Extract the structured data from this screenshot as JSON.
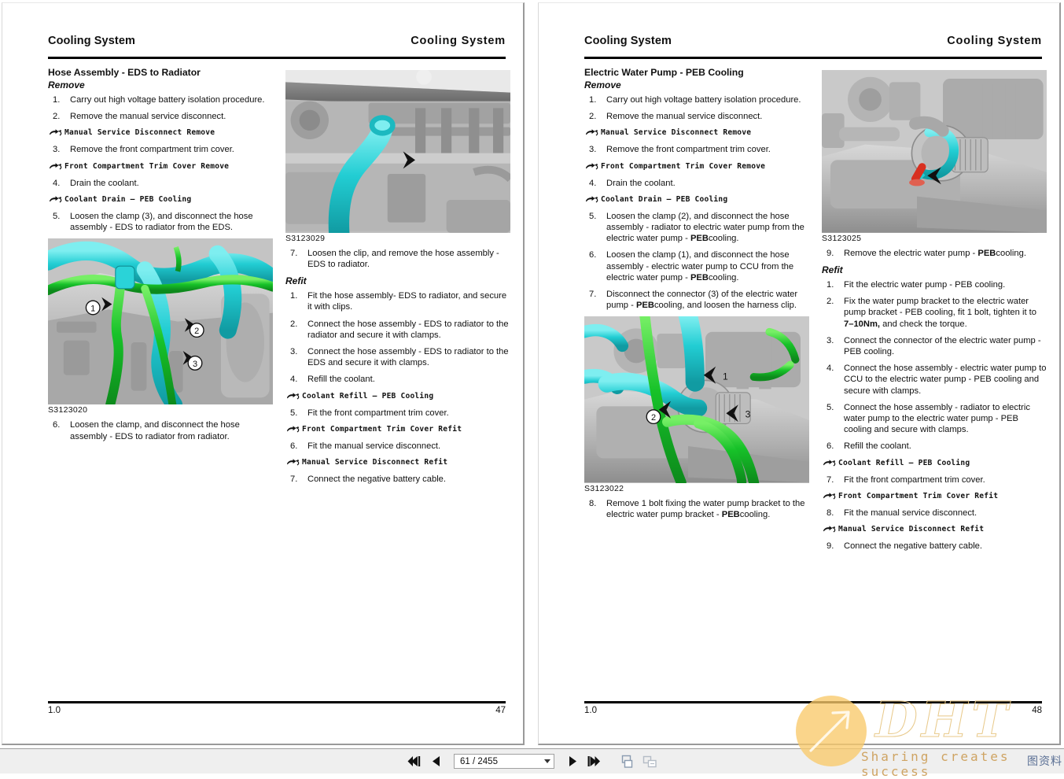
{
  "viewer": {
    "toolbar": {
      "first_page_label": "First page",
      "prev_page_label": "Previous page",
      "next_page_label": "Next page",
      "last_page_label": "Last page",
      "page_indicator": "61 / 2455",
      "single_page_view_label": "Single page view",
      "two_page_view_label": "Two page view"
    },
    "watermark": {
      "logo_text": "DHT",
      "tagline": "Sharing creates success",
      "badge": "图资料"
    }
  },
  "pages": [
    {
      "header_left": "Cooling System",
      "header_right": "Cooling System",
      "footer_left": "1.0",
      "footer_right": "47",
      "col_a": {
        "title": "Hose Assembly - EDS to Radiator",
        "subtitle": "Remove",
        "blocks": [
          {
            "kind": "steps",
            "items": [
              {
                "num": "1.",
                "text": "Carry out high voltage battery isolation procedure."
              },
              {
                "num": "2.",
                "text": "Remove the manual service disconnect."
              }
            ]
          },
          {
            "kind": "xref",
            "text": "Manual Service Disconnect Remove"
          },
          {
            "kind": "steps",
            "items": [
              {
                "num": "3.",
                "text": "Remove the front compartment trim cover."
              }
            ]
          },
          {
            "kind": "xref",
            "text": "Front Compartment Trim Cover Remove"
          },
          {
            "kind": "steps",
            "items": [
              {
                "num": "4.",
                "text": "Drain the coolant."
              }
            ]
          },
          {
            "kind": "xref",
            "text": "Coolant Drain – PEB Cooling"
          },
          {
            "kind": "steps",
            "items": [
              {
                "num": "5.",
                "text": "Loosen the clamp (3), and disconnect the hose assembly - EDS to radiator from the EDS."
              }
            ]
          },
          {
            "kind": "figure",
            "id": "S3123020",
            "figure": "eds-hose-engine-bay"
          },
          {
            "kind": "steps",
            "items": [
              {
                "num": "6.",
                "text": "Loosen the clamp, and disconnect the hose assembly - EDS to radiator from radiator."
              }
            ]
          }
        ]
      },
      "col_b": {
        "blocks": [
          {
            "kind": "figure",
            "id": "S3123029",
            "figure": "radiator-hose-front"
          },
          {
            "kind": "steps",
            "items": [
              {
                "num": "7.",
                "text": "Loosen the clip, and remove the hose assembly - EDS to radiator."
              }
            ]
          },
          {
            "kind": "subtitle",
            "text": "Refit"
          },
          {
            "kind": "steps",
            "items": [
              {
                "num": "1.",
                "text": "Fit the hose assembly- EDS to radiator, and secure it with clips."
              },
              {
                "num": "2.",
                "text": "Connect the hose assembly - EDS to radiator to the radiator and secure it with clamps."
              },
              {
                "num": "3.",
                "text": "Connect the hose assembly - EDS to radiator to the EDS and secure it with clamps."
              },
              {
                "num": "4.",
                "text": "Refill the coolant."
              }
            ]
          },
          {
            "kind": "xref",
            "text": "Coolant Refill – PEB Cooling"
          },
          {
            "kind": "steps",
            "items": [
              {
                "num": "5.",
                "text": "Fit the front compartment trim cover."
              }
            ]
          },
          {
            "kind": "xref",
            "text": "Front Compartment Trim Cover Refit"
          },
          {
            "kind": "steps",
            "items": [
              {
                "num": "6.",
                "text": "Fit the manual service disconnect."
              }
            ]
          },
          {
            "kind": "xref",
            "text": "Manual Service Disconnect Refit"
          },
          {
            "kind": "steps",
            "items": [
              {
                "num": "7.",
                "text": "Connect the negative battery cable."
              }
            ]
          }
        ]
      }
    },
    {
      "header_left": "Cooling System",
      "header_right": "Cooling System",
      "footer_left": "1.0",
      "footer_right": "48",
      "col_a": {
        "title": "Electric Water Pump - PEB Cooling",
        "subtitle": "Remove",
        "blocks": [
          {
            "kind": "steps",
            "items": [
              {
                "num": "1.",
                "text": "Carry out high voltage battery isolation procedure."
              },
              {
                "num": "2.",
                "text": "Remove the manual service disconnect."
              }
            ]
          },
          {
            "kind": "xref",
            "text": "Manual Service Disconnect Remove"
          },
          {
            "kind": "steps",
            "items": [
              {
                "num": "3.",
                "text": "Remove the front compartment trim cover."
              }
            ]
          },
          {
            "kind": "xref",
            "text": "Front Compartment Trim Cover Remove"
          },
          {
            "kind": "steps",
            "items": [
              {
                "num": "4.",
                "text": "Drain the coolant."
              }
            ]
          },
          {
            "kind": "xref",
            "text": "Coolant Drain – PEB Cooling"
          },
          {
            "kind": "steps",
            "items": [
              {
                "num": "5.",
                "text": "Loosen the clamp (2), and disconnect the hose assembly - radiator to electric water pump from the electric water pump - ",
                "bold": "PEB",
                "tail": "cooling."
              },
              {
                "num": "6.",
                "text": "Loosen the clamp (1), and disconnect the hose assembly - electric water pump to CCU from the electric water pump - ",
                "bold": "PEB",
                "tail": "cooling."
              },
              {
                "num": "7.",
                "text": "Disconnect the connector (3) of the electric water pump - ",
                "bold": "PEB",
                "tail": "cooling, and loosen the harness clip."
              }
            ]
          },
          {
            "kind": "figure",
            "id": "S3123022",
            "figure": "water-pump-assembly"
          },
          {
            "kind": "steps",
            "items": [
              {
                "num": "8.",
                "text": "Remove 1 bolt fixing the water pump bracket to the electric water pump bracket - ",
                "bold": "PEB",
                "tail": "cooling."
              }
            ]
          }
        ]
      },
      "col_b": {
        "blocks": [
          {
            "kind": "figure",
            "id": "S3123025",
            "figure": "water-pump-removal"
          },
          {
            "kind": "steps",
            "items": [
              {
                "num": "9.",
                "text": "Remove the electric water pump - ",
                "bold": "PEB",
                "tail": "cooling."
              }
            ]
          },
          {
            "kind": "subtitle",
            "text": "Refit"
          },
          {
            "kind": "steps",
            "items": [
              {
                "num": "1.",
                "text": "Fit the electric water pump - PEB cooling."
              },
              {
                "num": "2.",
                "text": "Fix the water pump bracket to the electric water pump bracket - PEB cooling, fit 1 bolt, tighten it to ",
                "bold": "7–10Nm,",
                "tail": " and check the torque."
              },
              {
                "num": "3.",
                "text": "Connect the connector of the electric water pump - PEB cooling."
              },
              {
                "num": "4.",
                "text": "Connect the hose assembly - electric water pump to CCU to the electric water pump - PEB cooling and secure with clamps."
              },
              {
                "num": "5.",
                "text": "Connect the hose assembly - radiator to electric water pump to the electric water pump - PEB cooling and secure with clamps."
              },
              {
                "num": "6.",
                "text": "Refill the coolant."
              }
            ]
          },
          {
            "kind": "xref",
            "text": "Coolant Refill – PEB Cooling"
          },
          {
            "kind": "steps",
            "items": [
              {
                "num": "7.",
                "text": "Fit the front compartment trim cover."
              }
            ]
          },
          {
            "kind": "xref",
            "text": "Front Compartment Trim Cover Refit"
          },
          {
            "kind": "steps",
            "items": [
              {
                "num": "8.",
                "text": "Fit the manual service disconnect."
              }
            ]
          },
          {
            "kind": "xref",
            "text": "Manual Service Disconnect Refit"
          },
          {
            "kind": "steps",
            "items": [
              {
                "num": "9.",
                "text": "Connect the negative battery cable."
              }
            ]
          }
        ]
      }
    }
  ],
  "colors": {
    "hose_cyan": "#2ad3d8",
    "hose_green": "#19c22a",
    "metal_grey": "#b5b5b5",
    "watermark_gold": "#e8c98a"
  }
}
